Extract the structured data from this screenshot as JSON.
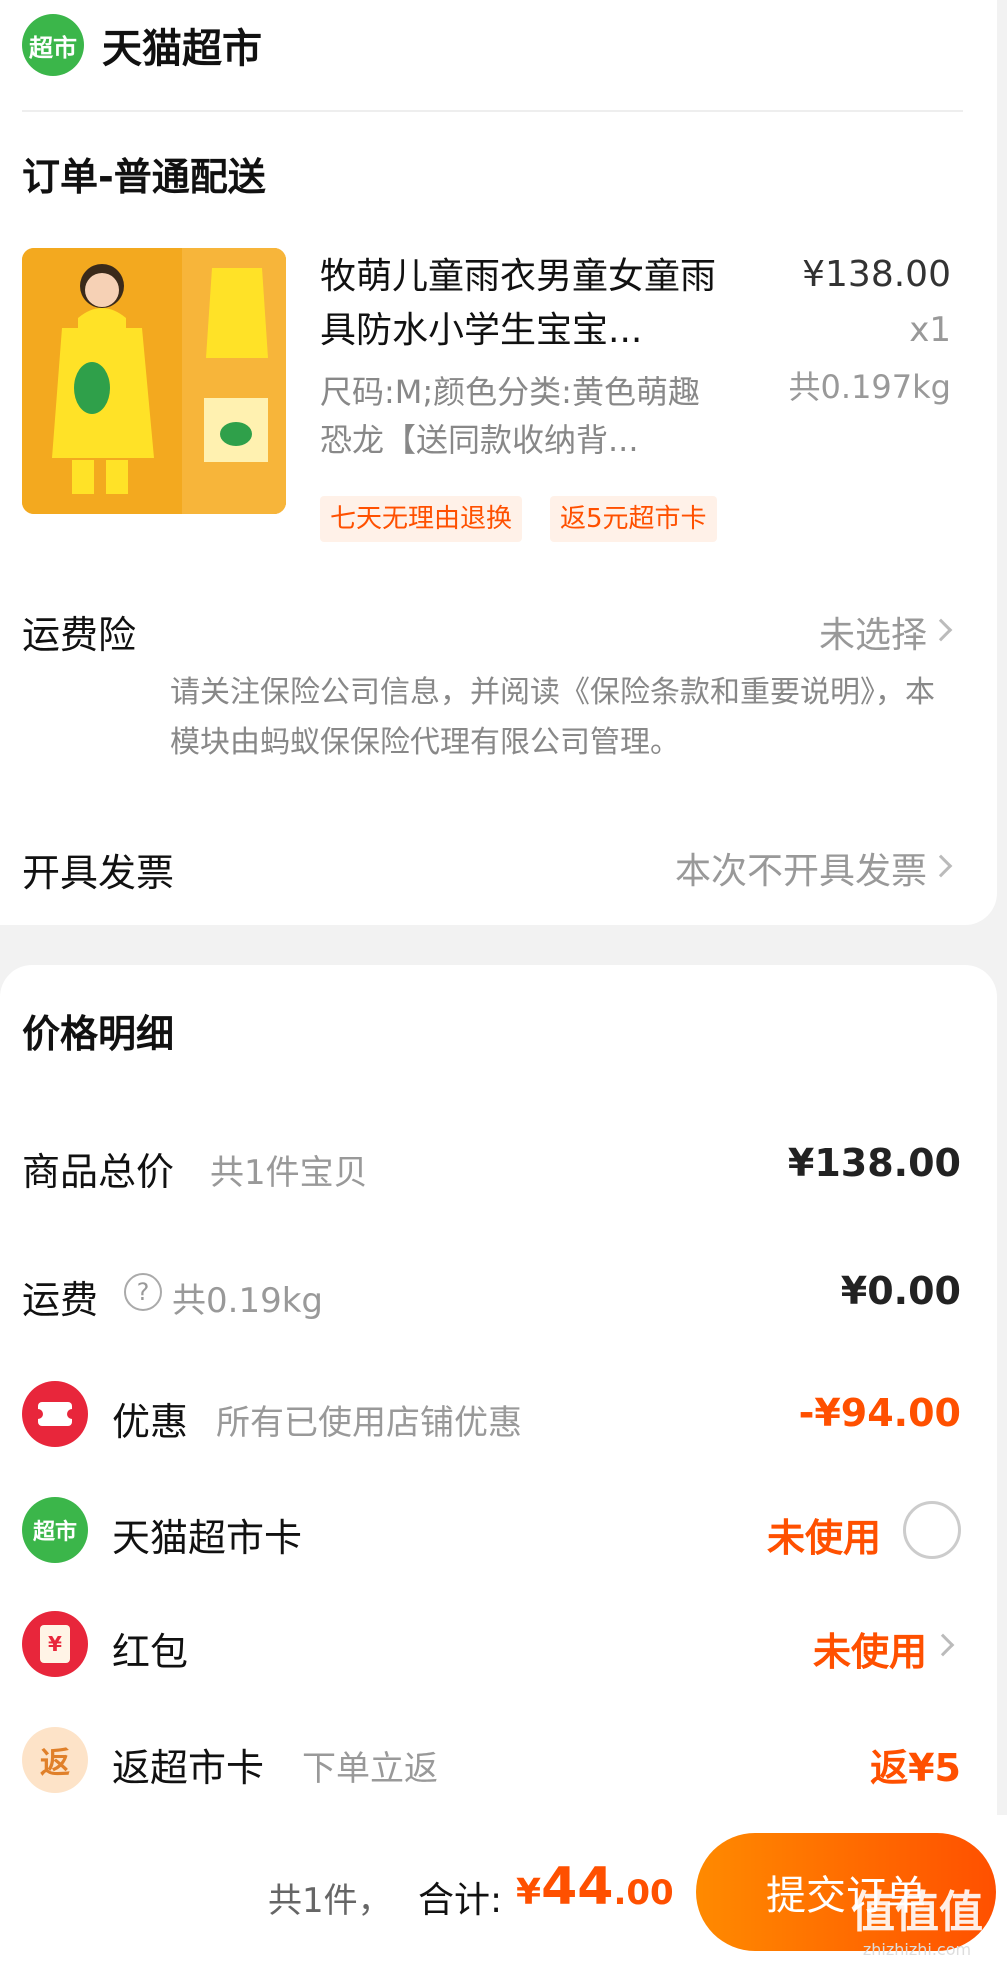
{
  "store": {
    "logo_text": "超市",
    "name": "天猫超市"
  },
  "order": {
    "section_title": "订单-普通配送",
    "product": {
      "title": "牧萌儿童雨衣男童女童雨具防水小学生宝宝...",
      "spec": "尺码:M;颜色分类:黄色萌趣恐龙【送同款收纳背...",
      "price": "¥138.00",
      "qty": "x1",
      "weight": "共0.197kg",
      "tags": [
        "七天无理由退换",
        "返5元超市卡"
      ]
    },
    "insurance": {
      "label": "运费险",
      "value": "未选择",
      "note": "请关注保险公司信息，并阅读《保险条款和重要说明》，本模块由蚂蚁保保险代理有限公司管理。"
    },
    "invoice": {
      "label": "开具发票",
      "value": "本次不开具发票"
    }
  },
  "price_detail": {
    "title": "价格明细",
    "goods_total": {
      "label": "商品总价",
      "sub": "共1件宝贝",
      "value": "¥138.00"
    },
    "shipping": {
      "label": "运费",
      "sub": "共0.19kg",
      "value": "¥0.00"
    },
    "discount": {
      "label": "优惠",
      "sub": "所有已使用店铺优惠",
      "value": "-¥94.00"
    },
    "tmall_card": {
      "icon_text": "超市",
      "label": "天猫超市卡",
      "value": "未使用"
    },
    "red_packet": {
      "icon_text": "¥",
      "label": "红包",
      "value": "未使用"
    },
    "cashback": {
      "icon_text": "返",
      "label": "返超市卡",
      "sub": "下单立返",
      "value": "返¥5"
    }
  },
  "footer": {
    "count": "共1件，",
    "total_label": "合计:",
    "currency": "¥",
    "amount_int": "44",
    "amount_dec": ".00",
    "submit_label": "提交订单"
  },
  "watermark": {
    "text": "值值值",
    "sub": "zhizhizhi.com"
  },
  "colors": {
    "accent": "#ff5000",
    "store_green": "#3bb64a",
    "discount_red": "#e8263b"
  }
}
